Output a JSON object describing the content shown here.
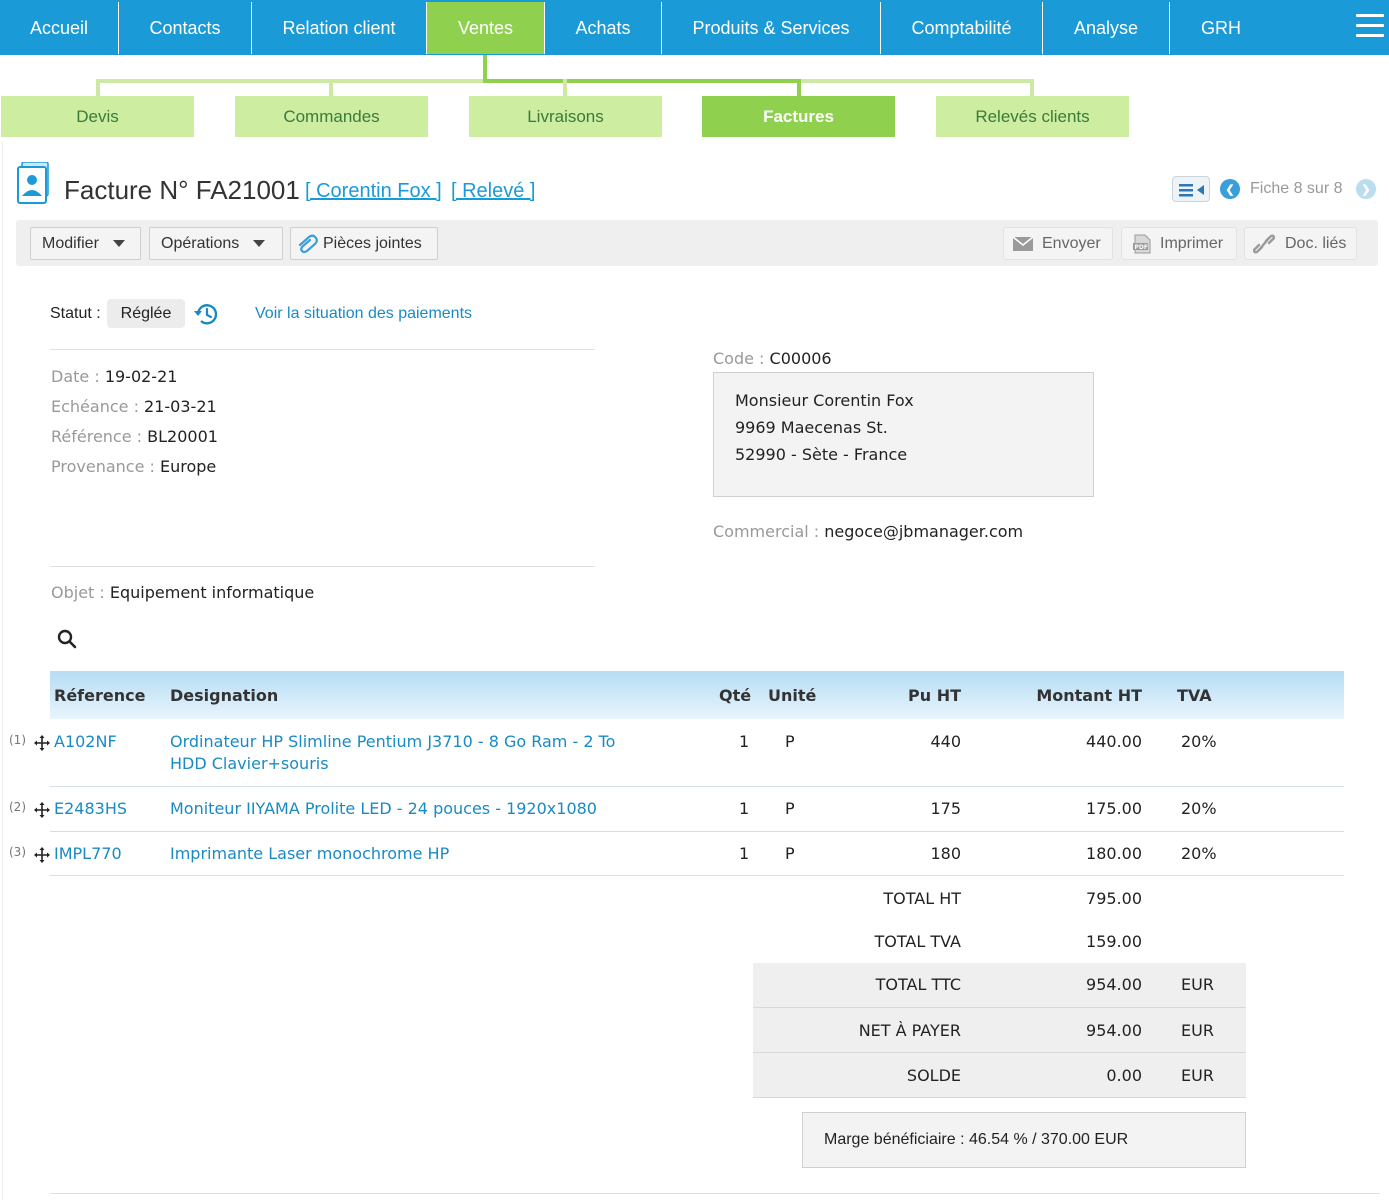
{
  "topnav": {
    "items": [
      "Accueil",
      "Contacts",
      "Relation client",
      "Ventes",
      "Achats",
      "Produits & Services",
      "Comptabilité",
      "Analyse",
      "GRH"
    ],
    "active": "Ventes"
  },
  "subnav": {
    "items": [
      "Devis",
      "Commandes",
      "Livraisons",
      "Factures",
      "Relevés clients"
    ],
    "active": "Factures"
  },
  "header": {
    "title": "Facture N° FA21001",
    "client_link": "[ Corentin Fox ]",
    "releve_link": "[ Relevé ]",
    "fiche": "Fiche 8 sur 8"
  },
  "toolbar": {
    "modifier": "Modifier",
    "operations": "Opérations",
    "pieces": "Pièces jointes",
    "envoyer": "Envoyer",
    "imprimer": "Imprimer",
    "doc_lies": "Doc. liés"
  },
  "status": {
    "label": "Statut :",
    "value": "Réglée",
    "link": "Voir la situation des paiements"
  },
  "invoice": {
    "date_label": "Date :",
    "date": "19-02-21",
    "echeance_label": "Echéance :",
    "echeance": "21-03-21",
    "reference_label": "Référence :",
    "reference": "BL20001",
    "provenance_label": "Provenance :",
    "provenance": "Europe",
    "objet_label": "Objet :",
    "objet": "Equipement informatique"
  },
  "client": {
    "code_label": "Code :",
    "code": "C00006",
    "address": [
      "Monsieur Corentin Fox",
      "9969 Maecenas St.",
      "52990 - Sète - France"
    ],
    "commercial_label": "Commercial :",
    "commercial": "negoce@jbmanager.com"
  },
  "table": {
    "headers": {
      "ref": "Réference",
      "designation": "Designation",
      "qte": "Qté",
      "unite": "Unité",
      "pu": "Pu HT",
      "montant": "Montant HT",
      "tva": "TVA"
    },
    "rows": [
      {
        "num": "(1)",
        "ref": "A102NF",
        "designation": [
          "Ordinateur HP Slimline Pentium J3710 - 8 Go Ram - 2 To",
          "HDD Clavier+souris"
        ],
        "qte": "1",
        "unite": "P",
        "pu": "440",
        "montant": "440.00",
        "tva": "20%"
      },
      {
        "num": "(2)",
        "ref": "E2483HS",
        "designation": [
          "Moniteur IIYAMA Prolite LED - 24 pouces - 1920x1080"
        ],
        "qte": "1",
        "unite": "P",
        "pu": "175",
        "montant": "175.00",
        "tva": "20%"
      },
      {
        "num": "(3)",
        "ref": "IMPL770",
        "designation": [
          "Imprimante Laser monochrome HP"
        ],
        "qte": "1",
        "unite": "P",
        "pu": "180",
        "montant": "180.00",
        "tva": "20%"
      }
    ]
  },
  "totals": [
    {
      "label": "TOTAL HT",
      "value": "795.00",
      "currency": ""
    },
    {
      "label": "TOTAL TVA",
      "value": "159.00",
      "currency": ""
    },
    {
      "label": "TOTAL TTC",
      "value": "954.00",
      "currency": "EUR"
    },
    {
      "label": "NET À PAYER",
      "value": "954.00",
      "currency": "EUR"
    },
    {
      "label": "SOLDE",
      "value": "0.00",
      "currency": "EUR"
    }
  ],
  "marge": "Marge bénéficiaire : 46.54 % /  370.00 EUR",
  "colors": {
    "primary_blue": "#1a9ad6",
    "active_green": "#8fd14f",
    "light_green": "#cdeea0",
    "link_blue": "#1a8ac4"
  }
}
